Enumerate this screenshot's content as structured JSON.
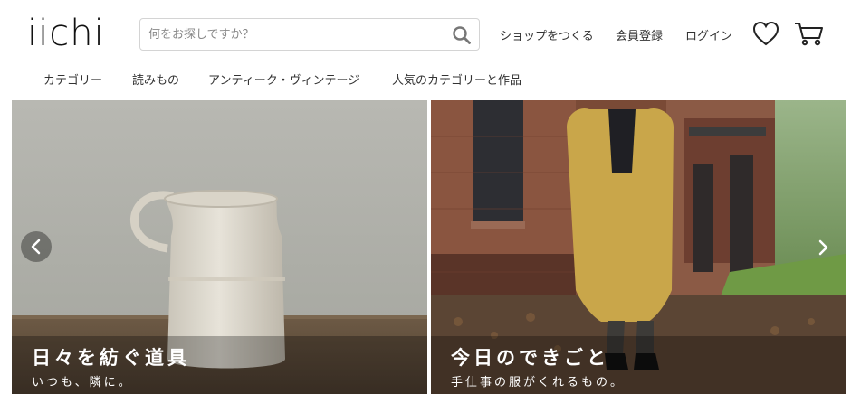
{
  "header": {
    "logo": "iichi",
    "search": {
      "placeholder": "何をお探しですか？",
      "value": ""
    },
    "links": {
      "open_shop": "ショップをつくる",
      "register": "会員登録",
      "login": "ログイン"
    },
    "icons": [
      "search-icon",
      "heart-icon",
      "cart-icon"
    ]
  },
  "nav": {
    "items": [
      {
        "label": "カテゴリー"
      },
      {
        "label": "読みもの"
      },
      {
        "label": "アンティーク・ヴィンテージ"
      },
      {
        "label": "人気のカテゴリーと作品"
      }
    ]
  },
  "carousel": {
    "slides": [
      {
        "title": "日々を紡ぐ道具",
        "subtitle": "いつも、隣に。"
      },
      {
        "title": "今日のできごと",
        "subtitle": "手仕事の服がくれるもの。"
      }
    ],
    "controls": [
      "chevron-left-icon",
      "chevron-right-icon"
    ]
  },
  "colors": {
    "text": "#333333",
    "logo": "#111111",
    "border": "#d4d4d4",
    "caption_overlay": "rgba(0,0,0,0.28)"
  }
}
